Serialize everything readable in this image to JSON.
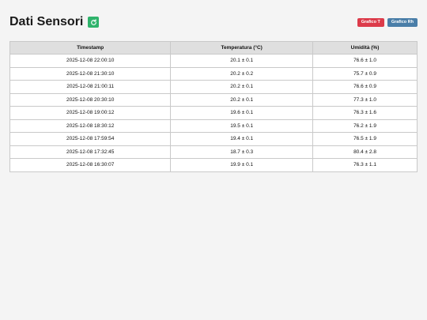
{
  "page": {
    "title": "Dati Sensori",
    "refresh_icon": "refresh-icon"
  },
  "actions": {
    "chart_t_label": "Grafico T",
    "chart_rh_label": "Grafico Rh",
    "chart_t_color": "#dc3b4a",
    "chart_rh_color": "#4a7ea8"
  },
  "table": {
    "headers": [
      "Timestamp",
      "Temperatura (°C)",
      "Umidità (%)"
    ],
    "rows": [
      [
        "2025-12-08 22:00:10",
        "20.1 ± 0.1",
        "76.6 ± 1.0"
      ],
      [
        "2025-12-08 21:30:10",
        "20.2 ± 0.2",
        "75.7 ± 0.9"
      ],
      [
        "2025-12-08 21:00:11",
        "20.2 ± 0.1",
        "76.6 ± 0.9"
      ],
      [
        "2025-12-08 20:30:10",
        "20.2 ± 0.1",
        "77.3 ± 1.0"
      ],
      [
        "2025-12-08 19:00:12",
        "19.6 ± 0.1",
        "76.3 ± 1.6"
      ],
      [
        "2025-12-08 18:30:12",
        "19.5 ± 0.1",
        "76.2 ± 1.9"
      ],
      [
        "2025-12-08 17:59:54",
        "19.4 ± 0.1",
        "76.5 ± 1.9"
      ],
      [
        "2025-12-08 17:32:45",
        "18.7 ± 0.3",
        "80.4 ± 2.8"
      ],
      [
        "2025-12-08 16:30:07",
        "19.9 ± 0.1",
        "76.3 ± 1.1"
      ]
    ]
  }
}
